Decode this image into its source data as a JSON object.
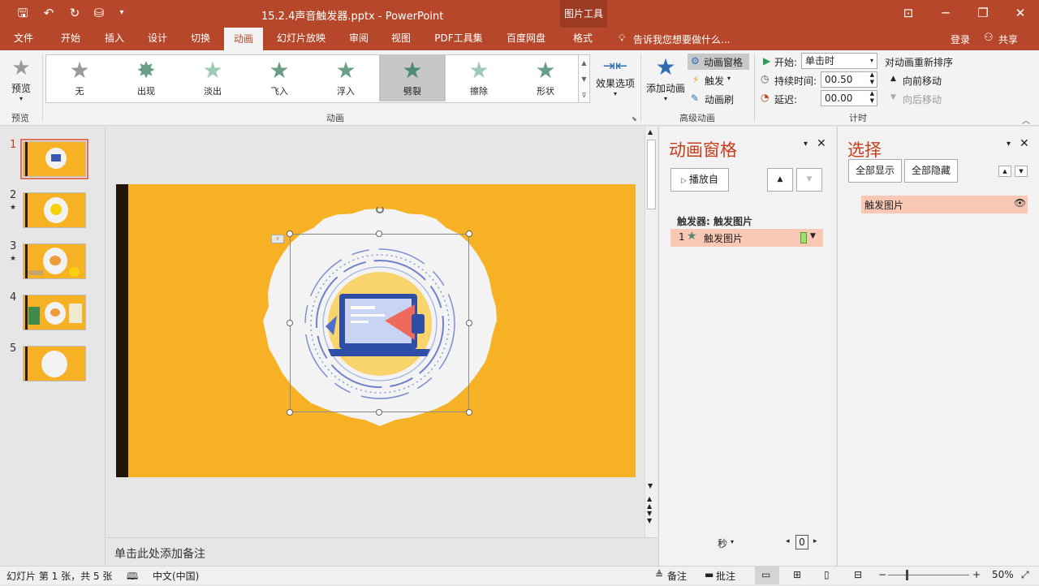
{
  "window": {
    "title": "15.2.4声音触发器.pptx - PowerPoint",
    "context_tool": "图片工具"
  },
  "tabs": [
    "文件",
    "开始",
    "插入",
    "设计",
    "切换",
    "动画",
    "幻灯片放映",
    "审阅",
    "视图",
    "PDF工具集",
    "百度网盘",
    "格式"
  ],
  "tell_me": "告诉我您想要做什么...",
  "account": {
    "login": "登录",
    "share": "共享"
  },
  "ribbon": {
    "preview_label": "预览",
    "preview_group": "预览",
    "animations_group": "动画",
    "animations": [
      "无",
      "出现",
      "淡出",
      "飞入",
      "浮入",
      "劈裂",
      "擦除",
      "形状"
    ],
    "effect_options": "效果选项",
    "add_animation": "添加动画",
    "animation_pane": "动画窗格",
    "trigger": "触发",
    "animation_painter": "动画刷",
    "advanced_group": "高级动画",
    "start_label": "开始:",
    "start_value": "单击时",
    "duration_label": "持续时间:",
    "duration_value": "00.50",
    "delay_label": "延迟:",
    "delay_value": "00.00",
    "reorder_title": "对动画重新排序",
    "move_earlier": "向前移动",
    "move_later": "向后移动",
    "timing_group": "计时"
  },
  "slides": [
    {
      "num": "1",
      "star": ""
    },
    {
      "num": "2",
      "star": "★"
    },
    {
      "num": "3",
      "star": "★"
    },
    {
      "num": "4",
      "star": ""
    },
    {
      "num": "5",
      "star": ""
    }
  ],
  "notes_placeholder": "单击此处添加备注",
  "animation_pane": {
    "title": "动画窗格",
    "play_from": "播放自",
    "trigger_heading": "触发器: 触发图片",
    "item_number": "1",
    "item_label": "触发图片",
    "seconds": "秒",
    "timeline_value": "0"
  },
  "selection_pane": {
    "title": "选择",
    "show_all": "全部显示",
    "hide_all": "全部隐藏",
    "item": "触发图片"
  },
  "status": {
    "slide_info": "幻灯片 第 1 张，共 5 张",
    "language": "中文(中国)",
    "notes": "备注",
    "comments": "批注",
    "zoom": "50%"
  },
  "colors": {
    "accent": "#b7472a",
    "slide_bg": "#f6b224",
    "selection_highlight": "#f8c8b4"
  }
}
